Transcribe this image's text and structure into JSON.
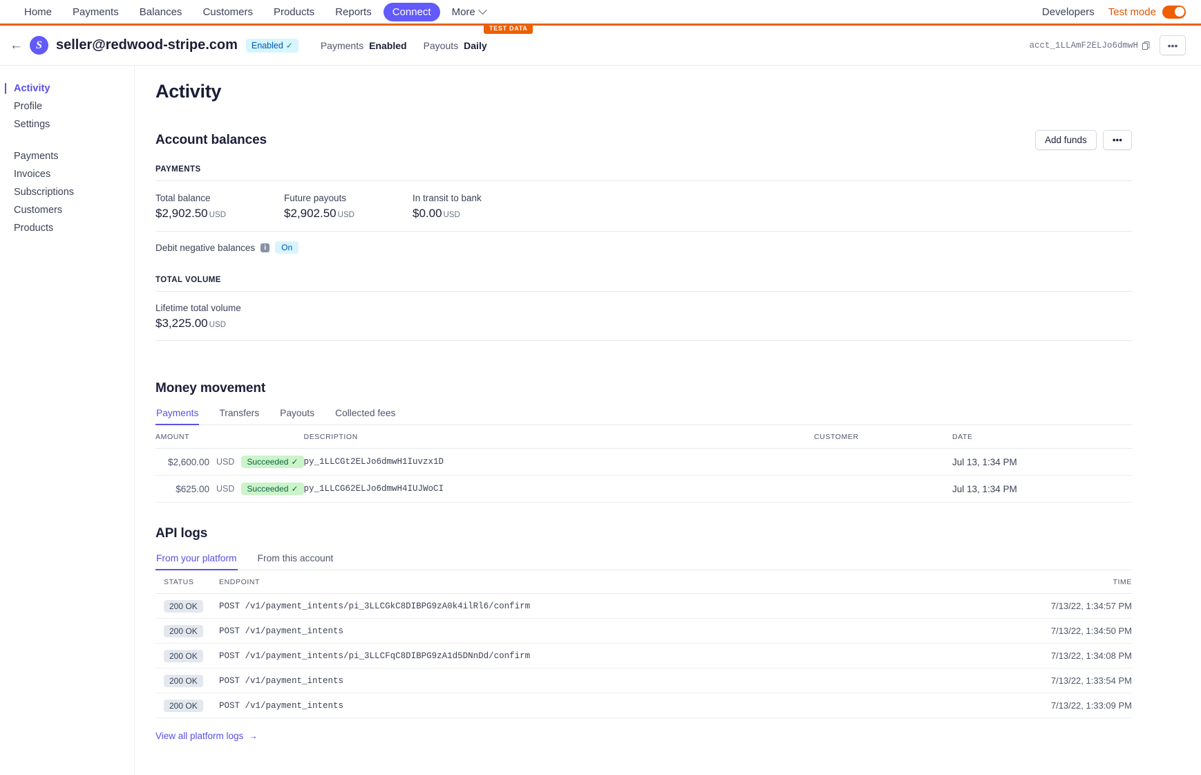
{
  "topnav": {
    "items": [
      {
        "label": "Home",
        "active": false
      },
      {
        "label": "Payments",
        "active": false
      },
      {
        "label": "Balances",
        "active": false
      },
      {
        "label": "Customers",
        "active": false
      },
      {
        "label": "Products",
        "active": false
      },
      {
        "label": "Reports",
        "active": false
      },
      {
        "label": "Connect",
        "active": true
      }
    ],
    "more_label": "More",
    "developers_label": "Developers",
    "test_mode_label": "Test mode",
    "test_mode_on": true,
    "accent_purple": "#625afa",
    "accent_orange": "#ed5f00"
  },
  "test_banner": {
    "label": "TEST DATA"
  },
  "account_header": {
    "back_label": "←",
    "avatar_letter": "S",
    "email": "seller@redwood-stripe.com",
    "status_badge": "Enabled",
    "payments_key": "Payments",
    "payments_value": "Enabled",
    "payouts_key": "Payouts",
    "payouts_value": "Daily",
    "account_id": "acct_1LLAmF2ELJo6dmwH"
  },
  "sidebar": {
    "group1": [
      {
        "label": "Activity",
        "active": true
      },
      {
        "label": "Profile",
        "active": false
      },
      {
        "label": "Settings",
        "active": false
      }
    ],
    "group2": [
      {
        "label": "Payments",
        "active": false
      },
      {
        "label": "Invoices",
        "active": false
      },
      {
        "label": "Subscriptions",
        "active": false
      },
      {
        "label": "Customers",
        "active": false
      },
      {
        "label": "Products",
        "active": false
      }
    ]
  },
  "page": {
    "title": "Activity"
  },
  "balances": {
    "title": "Account balances",
    "add_funds_label": "Add funds",
    "overflow_label": "•••",
    "payments_label": "PAYMENTS",
    "stats": [
      {
        "label": "Total balance",
        "value": "$2,902.50",
        "currency": "USD"
      },
      {
        "label": "Future payouts",
        "value": "$2,902.50",
        "currency": "USD"
      },
      {
        "label": "In transit to bank",
        "value": "$0.00",
        "currency": "USD"
      }
    ],
    "debit_label": "Debit negative balances",
    "debit_state": "On",
    "total_volume_label": "TOTAL VOLUME",
    "lifetime_label": "Lifetime total volume",
    "lifetime_value": "$3,225.00",
    "lifetime_currency": "USD"
  },
  "money_movement": {
    "title": "Money movement",
    "tabs": [
      {
        "label": "Payments",
        "active": true
      },
      {
        "label": "Transfers",
        "active": false
      },
      {
        "label": "Payouts",
        "active": false
      },
      {
        "label": "Collected fees",
        "active": false
      }
    ],
    "columns": [
      "AMOUNT",
      "DESCRIPTION",
      "CUSTOMER",
      "DATE"
    ],
    "rows": [
      {
        "amount": "$2,600.00",
        "currency": "USD",
        "status": "Succeeded",
        "description": "py_1LLCGt2ELJo6dmwH1Iuvzx1D",
        "customer": "",
        "date": "Jul 13, 1:34 PM"
      },
      {
        "amount": "$625.00",
        "currency": "USD",
        "status": "Succeeded",
        "description": "py_1LLCG62ELJo6dmwH4IUJWoCI",
        "customer": "",
        "date": "Jul 13, 1:34 PM"
      }
    ]
  },
  "api_logs": {
    "title": "API logs",
    "tabs": [
      {
        "label": "From your platform",
        "active": true
      },
      {
        "label": "From this account",
        "active": false
      }
    ],
    "columns": [
      "STATUS",
      "ENDPOINT",
      "TIME"
    ],
    "rows": [
      {
        "status": "200 OK",
        "method": "POST",
        "path": "/v1/payment_intents/pi_3LLCGkC8DIBPG9zA0k4ilRl6/confirm",
        "time": "7/13/22, 1:34:57 PM"
      },
      {
        "status": "200 OK",
        "method": "POST",
        "path": "/v1/payment_intents",
        "time": "7/13/22, 1:34:50 PM"
      },
      {
        "status": "200 OK",
        "method": "POST",
        "path": "/v1/payment_intents/pi_3LLCFqC8DIBPG9zA1d5DNnDd/confirm",
        "time": "7/13/22, 1:34:08 PM"
      },
      {
        "status": "200 OK",
        "method": "POST",
        "path": "/v1/payment_intents",
        "time": "7/13/22, 1:33:54 PM"
      },
      {
        "status": "200 OK",
        "method": "POST",
        "path": "/v1/payment_intents",
        "time": "7/13/22, 1:33:09 PM"
      }
    ],
    "view_all_label": "View all platform logs"
  }
}
